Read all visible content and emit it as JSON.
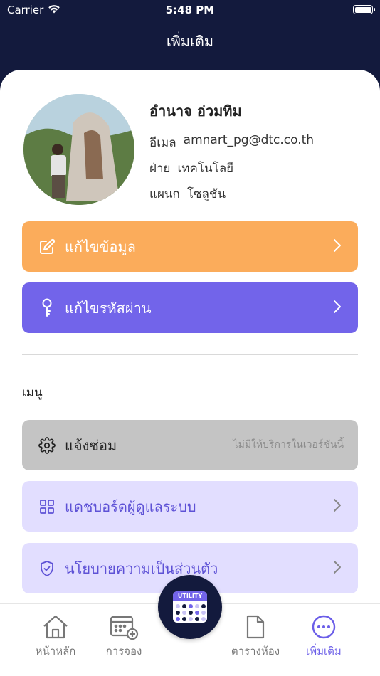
{
  "status_bar": {
    "carrier": "Carrier",
    "time": "5:48 PM"
  },
  "header": {
    "title": "เพิ่มเติม"
  },
  "profile": {
    "name": "อำนาจ อ่วมทิม",
    "email_label": "อีเมล",
    "email_value": "amnart_pg@dtc.co.th",
    "dept_label": "ฝ่าย",
    "dept_value": "เทคโนโลยี",
    "section_label": "แผนก",
    "section_value": "โซลูชัน"
  },
  "actions": {
    "edit_profile_label": "แก้ไขข้อมูล",
    "change_password_label": "แก้ไขรหัสผ่าน"
  },
  "menu": {
    "heading": "เมนู",
    "items": [
      {
        "label": "แจ้งซ่อม",
        "note": "ไม่มีให้บริการในเวอร์ชันนี้",
        "icon": "gear-icon"
      },
      {
        "label": "แดชบอร์ดผู้ดูแลระบบ",
        "icon": "grid-icon"
      },
      {
        "label": "นโยบายความเป็นส่วนตัว",
        "icon": "shield-check-icon"
      }
    ]
  },
  "tabbar": {
    "home": "หน้าหลัก",
    "booking": "การจอง",
    "schedule": "ตารางห้อง",
    "more": "เพิ่มเติม",
    "center_badge": "UTILITY"
  },
  "colors": {
    "navy": "#131a3d",
    "orange": "#fbac5b",
    "purple": "#7264ea",
    "lavender": "#e2deff",
    "gray": "#c4c4c4"
  }
}
